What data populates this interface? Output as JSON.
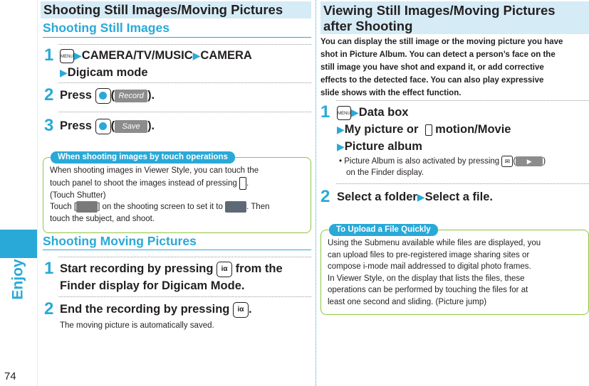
{
  "side_tab": {
    "label": "Enjoy",
    "page_number": "74"
  },
  "left": {
    "banner": "Shooting Still Images/Moving Pictures",
    "still": {
      "heading": "Shooting Still Images",
      "step1": {
        "num": "1",
        "key": "MENU",
        "a": "CAMERA/TV/MUSIC",
        "b": "CAMERA",
        "c": "Digicam mode"
      },
      "step2": {
        "num": "2",
        "text": "Press",
        "soft": "Record",
        "close": ").",
        "open": "("
      },
      "step3": {
        "num": "3",
        "text": "Press",
        "soft": "Save",
        "close": ").",
        "open": "("
      }
    },
    "touch_box": {
      "title": "When shooting images by touch operations",
      "line1": "When shooting images in Viewer Style, you can touch the",
      "line2a": "touch panel to shoot the images instead of pressing",
      "line2b": ".",
      "line3": "(Touch Shutter)",
      "line4a": "Touch [",
      "line4b": "] on the shooting screen to set it to",
      "line4c": ". Then",
      "line5": "touch the subject, and shoot."
    },
    "moving": {
      "heading": "Shooting Moving Pictures",
      "step1": {
        "num": "1",
        "a": "Start recording by pressing",
        "b": "from the",
        "c": "Finder display for Digicam Mode."
      },
      "step2": {
        "num": "2",
        "a": "End the recording by pressing",
        "b": ".",
        "note": "The moving picture is automatically saved."
      }
    }
  },
  "right": {
    "banner_line1": "Viewing Still Images/Moving Pictures",
    "banner_line2": "after Shooting",
    "intro": [
      "You can display the still image or the moving picture you have",
      "shot in Picture Album. You can detect a person’s face on the",
      "still image you have shot and expand it, or add corrective",
      "effects to the detected face. You can also play expressive",
      "slide shows with the effect function."
    ],
    "step1": {
      "num": "1",
      "key": "MENU",
      "a": "Data box",
      "b": "My picture or",
      "c": "motion/Movie",
      "d": "Picture album",
      "bullet_a": "Picture Album is also activated by pressing",
      "bullet_b": "on the Finder display.",
      "open": "(",
      "close": ")"
    },
    "step2": {
      "num": "2",
      "a": "Select a folder",
      "b": "Select a file."
    },
    "upload_box": {
      "title": "To Upload a File Quickly",
      "lines": [
        "Using the Submenu available while files are displayed, you",
        "can upload files to pre-registered image sharing sites or",
        "compose i-mode mail addressed to digital photo frames.",
        "In Viewer Style, on the display that lists the files, these",
        "operations can be performed by touching the files for at",
        "least one second and sliding. (Picture jump)"
      ]
    }
  },
  "colors": {
    "accent": "#29a9d8",
    "banner_bg": "#d5ebf6",
    "box_border": "#8dc63f"
  }
}
